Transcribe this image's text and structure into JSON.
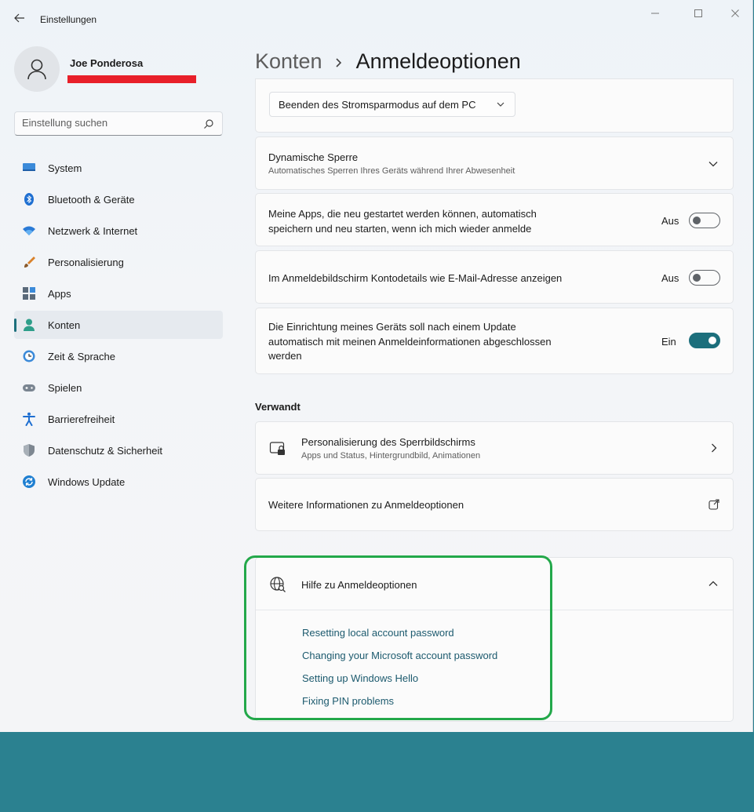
{
  "window": {
    "title": "Einstellungen"
  },
  "profile": {
    "name": "Joe Ponderosa"
  },
  "search": {
    "placeholder": "Einstellung suchen"
  },
  "sidebar": {
    "items": [
      {
        "label": "System",
        "icon": "monitor-icon"
      },
      {
        "label": "Bluetooth & Geräte",
        "icon": "bluetooth-icon"
      },
      {
        "label": "Netzwerk & Internet",
        "icon": "wifi-icon"
      },
      {
        "label": "Personalisierung",
        "icon": "brush-icon"
      },
      {
        "label": "Apps",
        "icon": "apps-icon"
      },
      {
        "label": "Konten",
        "icon": "account-icon"
      },
      {
        "label": "Zeit & Sprache",
        "icon": "clock-globe-icon"
      },
      {
        "label": "Spielen",
        "icon": "gamepad-icon"
      },
      {
        "label": "Barrierefreiheit",
        "icon": "accessibility-icon"
      },
      {
        "label": "Datenschutz & Sicherheit",
        "icon": "shield-icon"
      },
      {
        "label": "Windows Update",
        "icon": "update-icon"
      }
    ],
    "active_index": 5
  },
  "header": {
    "parent": "Konten",
    "current": "Anmeldeoptionen"
  },
  "settings": {
    "sleep_dropdown": "Beenden des Stromsparmodus auf dem PC",
    "dynamic_lock": {
      "title": "Dynamische Sperre",
      "subtitle": "Automatisches Sperren Ihres Geräts während Ihrer Abwesenheit"
    },
    "restart_apps": {
      "line1": "Meine Apps, die neu gestartet werden können, automatisch",
      "line2": "speichern und neu starten, wenn ich mich wieder anmelde",
      "state": "Aus",
      "on": false
    },
    "account_details": {
      "label": "Im Anmeldebildschirm Kontodetails wie E-Mail-Adresse anzeigen",
      "state": "Aus",
      "on": false
    },
    "finish_setup": {
      "line1": "Die Einrichtung meines Geräts soll nach einem Update",
      "line2": "automatisch mit meinen Anmeldeinformationen abgeschlossen",
      "line3": "werden",
      "state": "Ein",
      "on": true
    }
  },
  "related": {
    "heading": "Verwandt",
    "lockscreen": {
      "title": "Personalisierung des Sperrbildschirms",
      "subtitle": "Apps und Status, Hintergrundbild, Animationen"
    },
    "more_info": "Weitere Informationen zu Anmeldeoptionen"
  },
  "help": {
    "title": "Hilfe zu Anmeldeoptionen",
    "links": [
      "Resetting local account password",
      "Changing your Microsoft account password",
      "Setting up Windows Hello",
      "Fixing PIN problems"
    ]
  },
  "colors": {
    "accent": "#1c6f7c",
    "highlight": "#23a84a",
    "redaction": "#e8202a",
    "desktop": "#2b8190"
  }
}
